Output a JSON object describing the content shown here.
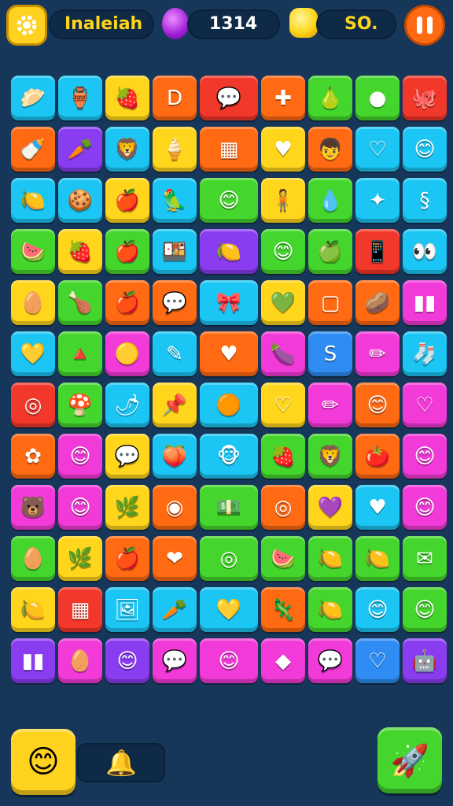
{
  "hud": {
    "player_name": "Inaleiah",
    "gems": "1314",
    "coins": "SO.",
    "settings_icon": "gear-icon",
    "gem_icon": "gem-balloon-icon",
    "coin_icon": "gold-coin-icon",
    "pause_icon": "pause-icon"
  },
  "colors": {
    "background": "#17375a",
    "cyan": "#1cc6f4",
    "yellow": "#ffd61c",
    "orange": "#ff6a13",
    "red": "#f2382a",
    "green": "#44d62c",
    "purple": "#8a3cf0",
    "magenta": "#f23ad8",
    "blue": "#2f8cf2"
  },
  "board": {
    "rows": [
      [
        [
          "cyan",
          "🥟"
        ],
        [
          "cyan",
          "🏺"
        ],
        [
          "yellow",
          "🍓"
        ],
        [
          "orange",
          "D"
        ],
        [
          "red",
          "💬"
        ],
        [
          "orange",
          "✚"
        ],
        [
          "green",
          "🍐"
        ],
        [
          "green",
          "●"
        ],
        [
          "red",
          "🐙"
        ]
      ],
      [
        [
          "orange",
          "🍼"
        ],
        [
          "purple",
          "🥕"
        ],
        [
          "cyan",
          "🦁"
        ],
        [
          "yellow",
          "🍦"
        ],
        [
          "orange",
          "▦"
        ],
        [
          "yellow",
          "♥"
        ],
        [
          "orange",
          "👦"
        ],
        [
          "cyan",
          "♡"
        ],
        [
          "cyan",
          "😊"
        ]
      ],
      [
        [
          "cyan",
          "🍋"
        ],
        [
          "cyan",
          "🍪"
        ],
        [
          "yellow",
          "🍎"
        ],
        [
          "cyan",
          "🦜"
        ],
        [
          "green",
          "😊"
        ],
        [
          "yellow",
          "🧍"
        ],
        [
          "green",
          "💧"
        ],
        [
          "cyan",
          "✦"
        ],
        [
          "cyan",
          "§"
        ]
      ],
      [
        [
          "green",
          "🍉"
        ],
        [
          "yellow",
          "🍓"
        ],
        [
          "green",
          "🍎"
        ],
        [
          "cyan",
          "🍱"
        ],
        [
          "purple",
          "🍋"
        ],
        [
          "green",
          "😊"
        ],
        [
          "green",
          "🍏"
        ],
        [
          "red",
          "📱"
        ],
        [
          "cyan",
          "👀"
        ]
      ],
      [
        [
          "yellow",
          "🥚"
        ],
        [
          "green",
          "🍗"
        ],
        [
          "orange",
          "🍎"
        ],
        [
          "orange",
          "💬"
        ],
        [
          "cyan",
          "🎀"
        ],
        [
          "yellow",
          "💚"
        ],
        [
          "orange",
          "▢"
        ],
        [
          "orange",
          "🥔"
        ],
        [
          "magenta",
          "▮▮"
        ]
      ],
      [
        [
          "cyan",
          "💛"
        ],
        [
          "green",
          "🔺"
        ],
        [
          "magenta",
          "🟡"
        ],
        [
          "cyan",
          "✎"
        ],
        [
          "orange",
          "♥"
        ],
        [
          "magenta",
          "🍆"
        ],
        [
          "blue",
          "S"
        ],
        [
          "magenta",
          "✏"
        ],
        [
          "cyan",
          "🧦"
        ]
      ],
      [
        [
          "red",
          "◎"
        ],
        [
          "green",
          "🍄"
        ],
        [
          "cyan",
          "🌶"
        ],
        [
          "yellow",
          "📌"
        ],
        [
          "cyan",
          "🟠"
        ],
        [
          "yellow",
          "♡"
        ],
        [
          "magenta",
          "✏"
        ],
        [
          "orange",
          "😊"
        ],
        [
          "magenta",
          "♡"
        ]
      ],
      [
        [
          "orange",
          "✿"
        ],
        [
          "magenta",
          "😊"
        ],
        [
          "yellow",
          "💬"
        ],
        [
          "cyan",
          "🍑"
        ],
        [
          "cyan",
          "🐵"
        ],
        [
          "green",
          "🍓"
        ],
        [
          "green",
          "🦁"
        ],
        [
          "orange",
          "🍅"
        ],
        [
          "magenta",
          "😊"
        ]
      ],
      [
        [
          "magenta",
          "🐻"
        ],
        [
          "magenta",
          "😊"
        ],
        [
          "yellow",
          "🌿"
        ],
        [
          "orange",
          "◉"
        ],
        [
          "green",
          "💵"
        ],
        [
          "orange",
          "◎"
        ],
        [
          "yellow",
          "💜"
        ],
        [
          "cyan",
          "♥"
        ],
        [
          "magenta",
          "😊"
        ]
      ],
      [
        [
          "green",
          "🥚"
        ],
        [
          "yellow",
          "🌿"
        ],
        [
          "orange",
          "🍎"
        ],
        [
          "orange",
          "❤"
        ],
        [
          "green",
          "◎"
        ],
        [
          "green",
          "🍉"
        ],
        [
          "green",
          "🍋"
        ],
        [
          "green",
          "🍋"
        ],
        [
          "green",
          "✉"
        ]
      ],
      [
        [
          "yellow",
          "🍋"
        ],
        [
          "red",
          "▦"
        ],
        [
          "cyan",
          "🖼"
        ],
        [
          "cyan",
          "🥕"
        ],
        [
          "cyan",
          "💛"
        ],
        [
          "orange",
          "🦎"
        ],
        [
          "green",
          "🍋"
        ],
        [
          "cyan",
          "😊"
        ],
        [
          "green",
          "😊"
        ]
      ],
      [
        [
          "purple",
          "▮▮"
        ],
        [
          "magenta",
          "🥚"
        ],
        [
          "purple",
          "😊"
        ],
        [
          "magenta",
          "💬"
        ],
        [
          "magenta",
          "😊"
        ],
        [
          "magenta",
          "◆"
        ],
        [
          "magenta",
          "💬"
        ],
        [
          "blue",
          "♡"
        ],
        [
          "purple",
          "🤖"
        ]
      ]
    ]
  },
  "powerups": {
    "left_icon": "smiley-helper-icon",
    "tray_icon": "bell-icon",
    "right_icon": "rocket-icon"
  }
}
